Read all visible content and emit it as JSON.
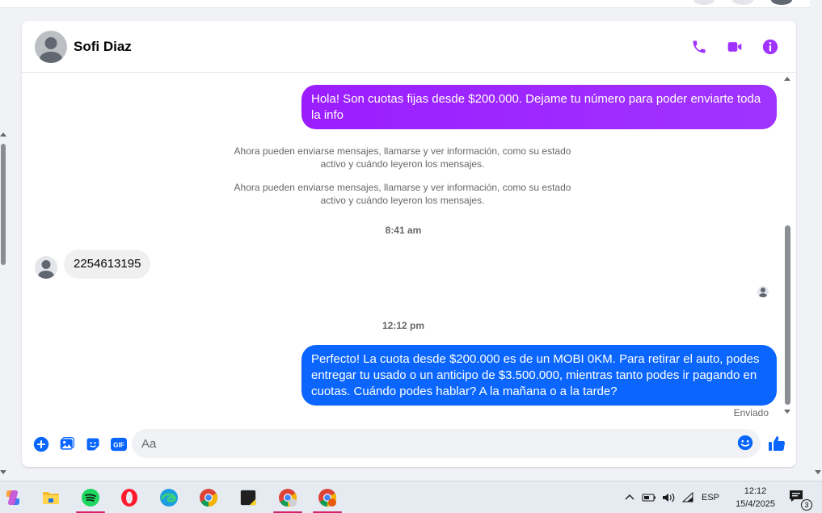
{
  "contact": {
    "name": "Sofi Diaz"
  },
  "messages": {
    "first_outgoing": "Hola! Son cuotas fijas desde $200.000. Dejame tu número para poder enviarte toda la info",
    "system_note_1": "Ahora pueden enviarse mensajes, llamarse y ver información, como su estado activo y cuándo leyeron los mensajes.",
    "system_note_2": "Ahora pueden enviarse mensajes, llamarse y ver información, como su estado activo y cuándo leyeron los mensajes.",
    "time_1": "8:41 am",
    "incoming": "2254613195",
    "time_2": "12:12 pm",
    "second_outgoing": "Perfecto! La cuota desde $200.000 es de un MOBI 0KM. Para retirar el auto, podes entregar tu usado o un anticipo de $3.500.000, mientras tanto podes ir pagando en cuotas. Cuándo podes hablar? A la mañana o a la tarde?",
    "status": "Enviado"
  },
  "composer": {
    "placeholder": "Aa",
    "gif_label": "GIF"
  },
  "taskbar": {
    "language": "ESP",
    "time": "12:12",
    "date": "15/4/2025",
    "notification_count": "3"
  },
  "colors": {
    "accent_purple": "#a033ff",
    "bubble_blue": "#0a66ff",
    "composer_blue": "#0866ff"
  }
}
